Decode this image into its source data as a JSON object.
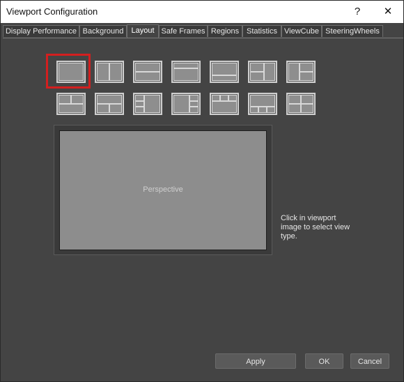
{
  "window": {
    "title": "Viewport Configuration",
    "help_glyph": "?",
    "close_glyph": "✕"
  },
  "tabs": [
    {
      "label": "Display Performance",
      "active": false
    },
    {
      "label": "Background",
      "active": false
    },
    {
      "label": "Layout",
      "active": true
    },
    {
      "label": "Safe Frames",
      "active": false
    },
    {
      "label": "Regions",
      "active": false
    },
    {
      "label": "Statistics",
      "active": false
    },
    {
      "label": "ViewCube",
      "active": false
    },
    {
      "label": "SteeringWheels",
      "active": false
    }
  ],
  "layouts": {
    "count": 14,
    "selected_index": 0,
    "selection_color": "#d41f1f"
  },
  "preview": {
    "viewport_label": "Perspective"
  },
  "hint": {
    "text": "Click in viewport image to select view type."
  },
  "buttons": {
    "apply": "Apply",
    "ok": "OK",
    "cancel": "Cancel"
  },
  "colors": {
    "background": "#444444",
    "viewport": "#8d8d8d",
    "titlebar": "#ffffff"
  }
}
